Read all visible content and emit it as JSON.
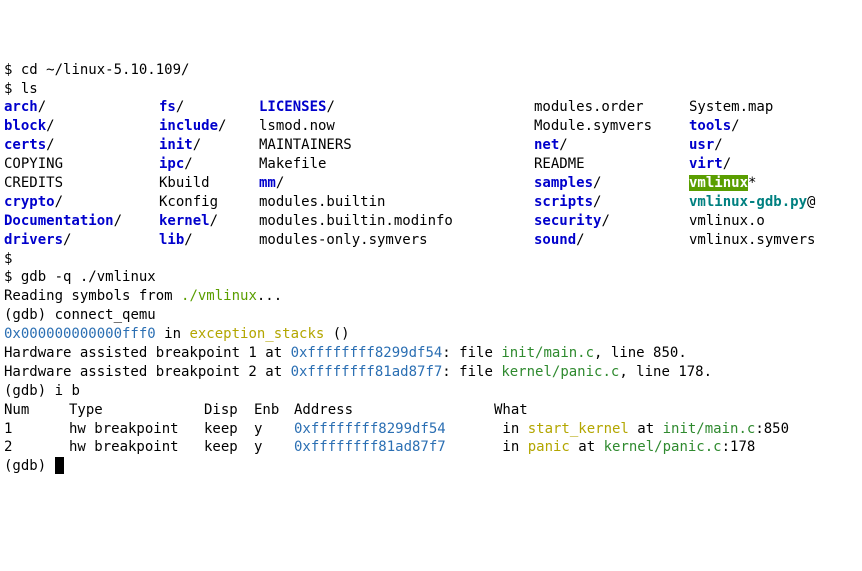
{
  "prompt": "$",
  "cmd_cd": "cd ~/linux-5.10.109/",
  "cmd_ls": "ls",
  "ls_rows": [
    [
      {
        "text": "arch",
        "cls": "blue",
        "suffix": "/"
      },
      {
        "text": "fs",
        "cls": "blue",
        "suffix": "/"
      },
      {
        "text": "LICENSES",
        "cls": "blue",
        "suffix": "/"
      },
      {
        "text": "modules.order",
        "cls": "",
        "suffix": ""
      },
      {
        "text": "System.map",
        "cls": "",
        "suffix": ""
      }
    ],
    [
      {
        "text": "block",
        "cls": "blue",
        "suffix": "/"
      },
      {
        "text": "include",
        "cls": "blue",
        "suffix": "/"
      },
      {
        "text": "lsmod.now",
        "cls": "",
        "suffix": ""
      },
      {
        "text": "Module.symvers",
        "cls": "",
        "suffix": ""
      },
      {
        "text": "tools",
        "cls": "blue",
        "suffix": "/"
      }
    ],
    [
      {
        "text": "certs",
        "cls": "blue",
        "suffix": "/"
      },
      {
        "text": "init",
        "cls": "blue",
        "suffix": "/"
      },
      {
        "text": "MAINTAINERS",
        "cls": "",
        "suffix": ""
      },
      {
        "text": "net",
        "cls": "blue",
        "suffix": "/"
      },
      {
        "text": "usr",
        "cls": "blue",
        "suffix": "/"
      }
    ],
    [
      {
        "text": "COPYING",
        "cls": "",
        "suffix": ""
      },
      {
        "text": "ipc",
        "cls": "blue",
        "suffix": "/"
      },
      {
        "text": "Makefile",
        "cls": "",
        "suffix": ""
      },
      {
        "text": "README",
        "cls": "",
        "suffix": ""
      },
      {
        "text": "virt",
        "cls": "blue",
        "suffix": "/"
      }
    ],
    [
      {
        "text": "CREDITS",
        "cls": "",
        "suffix": ""
      },
      {
        "text": "Kbuild",
        "cls": "",
        "suffix": ""
      },
      {
        "text": "mm",
        "cls": "blue",
        "suffix": "/"
      },
      {
        "text": "samples",
        "cls": "blue",
        "suffix": "/"
      },
      {
        "text": "vmlinux",
        "cls": "hlgreen",
        "suffix": "*"
      }
    ],
    [
      {
        "text": "crypto",
        "cls": "blue",
        "suffix": "/"
      },
      {
        "text": "Kconfig",
        "cls": "",
        "suffix": ""
      },
      {
        "text": "modules.builtin",
        "cls": "",
        "suffix": ""
      },
      {
        "text": "scripts",
        "cls": "blue",
        "suffix": "/"
      },
      {
        "text": "vmlinux-gdb.py",
        "cls": "teal",
        "suffix": "@"
      }
    ],
    [
      {
        "text": "Documentation",
        "cls": "blue",
        "suffix": "/"
      },
      {
        "text": "kernel",
        "cls": "blue",
        "suffix": "/"
      },
      {
        "text": "modules.builtin.modinfo",
        "cls": "",
        "suffix": ""
      },
      {
        "text": "security",
        "cls": "blue",
        "suffix": "/"
      },
      {
        "text": "vmlinux.o",
        "cls": "",
        "suffix": ""
      }
    ],
    [
      {
        "text": "drivers",
        "cls": "blue",
        "suffix": "/"
      },
      {
        "text": "lib",
        "cls": "blue",
        "suffix": "/"
      },
      {
        "text": "modules-only.symvers",
        "cls": "",
        "suffix": ""
      },
      {
        "text": "sound",
        "cls": "blue",
        "suffix": "/"
      },
      {
        "text": "vmlinux.symvers",
        "cls": "",
        "suffix": ""
      }
    ]
  ],
  "cmd_gdb": "gdb -q ./vmlinux",
  "reading_prefix": "Reading symbols from ",
  "reading_path": "./vmlinux",
  "reading_suffix": "...",
  "gdb_prompt": "(gdb)",
  "cmd_connect": "connect_qemu",
  "stop_addr": "0x000000000000fff0",
  "stop_in": " in ",
  "stop_sym": "exception_stacks",
  "stop_tail": " ()",
  "hb1_prefix": "Hardware assisted breakpoint 1 at ",
  "hb1_addr": "0xffffffff8299df54",
  "hb1_mid": ": file ",
  "hb1_file": "init/main.c",
  "hb1_tail": ", line 850.",
  "hb2_prefix": "Hardware assisted breakpoint 2 at ",
  "hb2_addr": "0xffffffff81ad87f7",
  "hb2_mid": ": file ",
  "hb2_file": "kernel/panic.c",
  "hb2_tail": ", line 178.",
  "cmd_ib": "i b",
  "bp_header": {
    "num": "Num",
    "type": "Type",
    "disp": "Disp ",
    "enb": "Enb ",
    "addr": "Address",
    "what": "What"
  },
  "bp_rows": [
    {
      "num": "1",
      "type": "hw breakpoint",
      "disp": "keep ",
      "enb": "y",
      "addr": "0xffffffff8299df54",
      "in": " in ",
      "sym": "start_kernel",
      "at": " at ",
      "file": "init/main.c",
      "line": ":850"
    },
    {
      "num": "2",
      "type": "hw breakpoint",
      "disp": "keep ",
      "enb": "y",
      "addr": "0xffffffff81ad87f7",
      "in": " in ",
      "sym": "panic",
      "at": " at ",
      "file": "kernel/panic.c",
      "line": ":178"
    }
  ]
}
